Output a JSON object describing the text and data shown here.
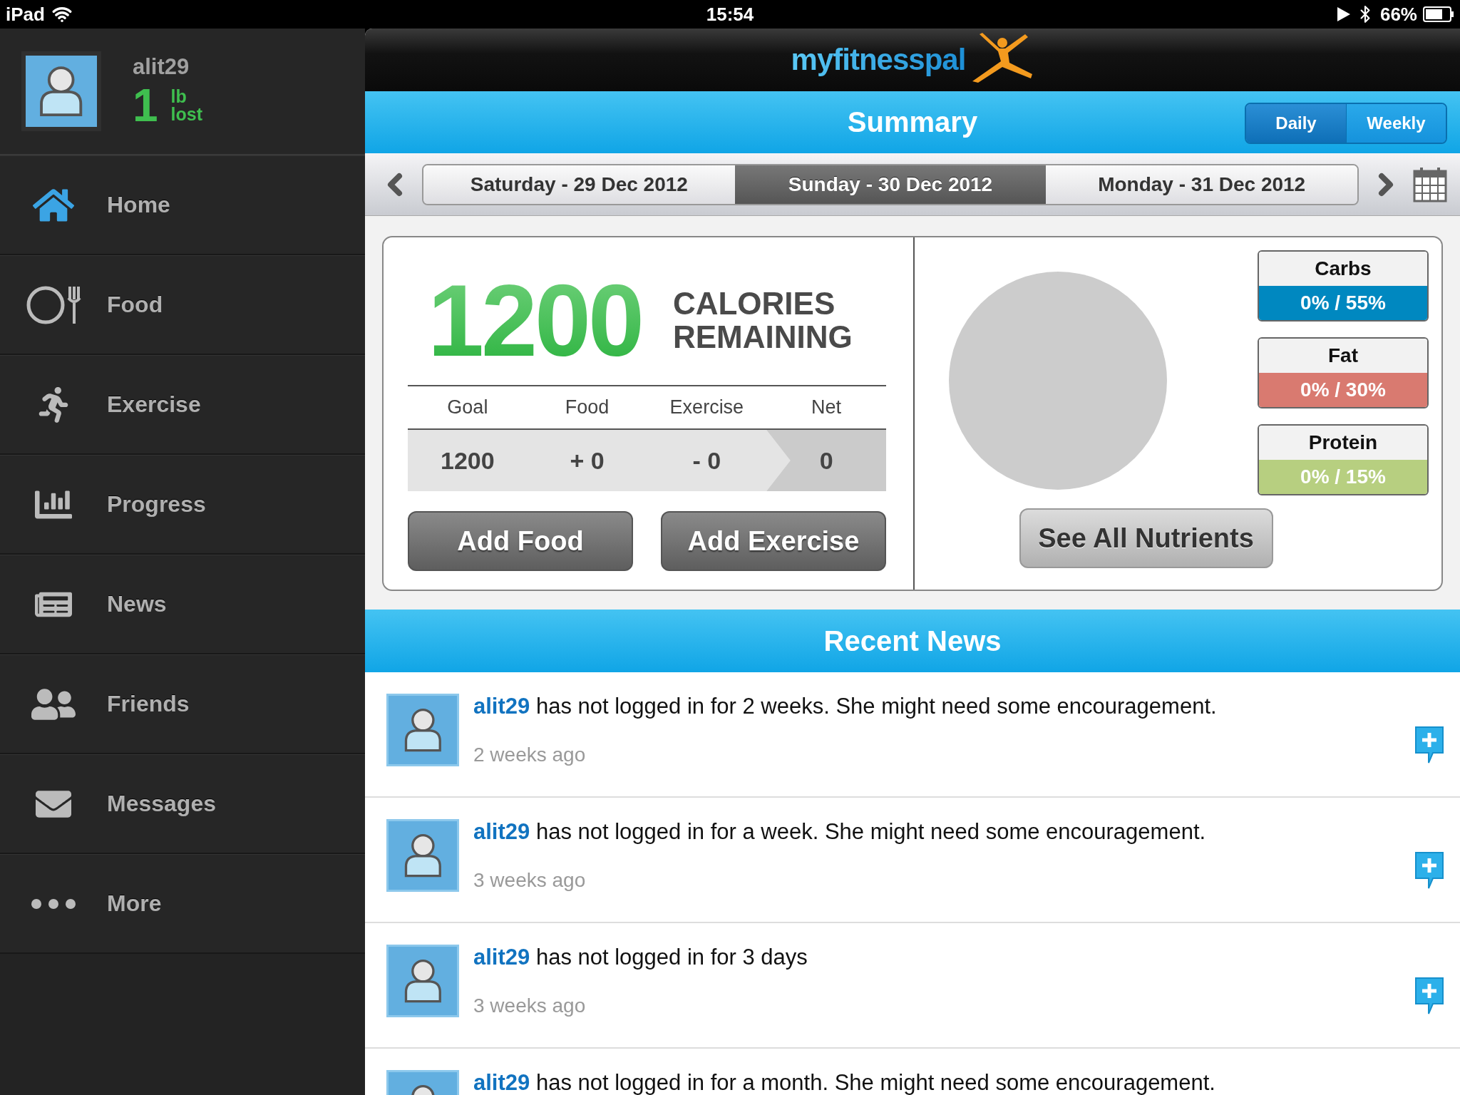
{
  "status_bar": {
    "device": "iPad",
    "time": "15:54",
    "battery": "66%"
  },
  "profile": {
    "username": "alit29",
    "weight_change": "1",
    "unit": "lb",
    "change_label": "lost"
  },
  "sidebar": {
    "items": [
      {
        "label": "Home"
      },
      {
        "label": "Food"
      },
      {
        "label": "Exercise"
      },
      {
        "label": "Progress"
      },
      {
        "label": "News"
      },
      {
        "label": "Friends"
      },
      {
        "label": "Messages"
      },
      {
        "label": "More"
      }
    ]
  },
  "header": {
    "logo": "myfitnesspal"
  },
  "summary": {
    "title": "Summary",
    "view_toggle": [
      {
        "label": "Daily",
        "selected": true
      },
      {
        "label": "Weekly",
        "selected": false
      }
    ]
  },
  "date_tabs": [
    {
      "label": "Saturday - 29 Dec 2012",
      "selected": false
    },
    {
      "label": "Sunday - 30 Dec 2012",
      "selected": true
    },
    {
      "label": "Monday - 31 Dec 2012",
      "selected": false
    }
  ],
  "calories": {
    "value": "1200",
    "label_line_1": "CALORIES",
    "label_line_2": "REMAINING",
    "columns": [
      {
        "label": "Goal",
        "value": "1200",
        "kind": "plain"
      },
      {
        "label": "Food",
        "value": "+ 0",
        "kind": "plain"
      },
      {
        "label": "Exercise",
        "value": "- 0",
        "kind": "plain"
      },
      {
        "label": "Net",
        "value": "0",
        "kind": "net"
      }
    ],
    "buttons": [
      "Add Food",
      "Add Exercise"
    ]
  },
  "nutrients": [
    {
      "name": "Carbs",
      "reading": "0% / 55%",
      "color": "#0088c0"
    },
    {
      "name": "Fat",
      "reading": "0% / 30%",
      "color": "#d97a70"
    },
    {
      "name": "Protein",
      "reading": "0% / 15%",
      "color": "#b7cf80"
    }
  ],
  "nutrients_button": "See All Nutrients",
  "recent_news": {
    "title": "Recent News",
    "items": [
      {
        "user": "alit29",
        "text": "has not logged in for 2 weeks. She might need some encouragement.",
        "time": "2 weeks ago"
      },
      {
        "user": "alit29",
        "text": "has not logged in for a week. She might need some encouragement.",
        "time": "3 weeks ago"
      },
      {
        "user": "alit29",
        "text": "has not logged in for 3 days",
        "time": "3 weeks ago"
      },
      {
        "user": "alit29",
        "text": "has not logged in for a month. She might need some encouragement."
      }
    ]
  }
}
